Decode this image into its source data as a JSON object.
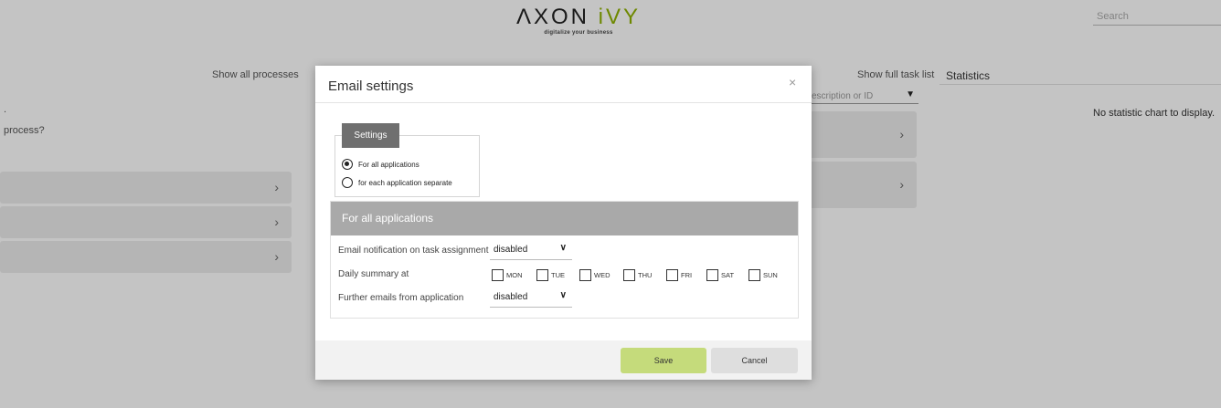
{
  "header": {
    "logo_main_prefix": "ΛXON ",
    "logo_main_accent": "iVY",
    "logo_sub": "digitalize your business",
    "search_placeholder": "Search"
  },
  "processes": {
    "show_all_label": "Show all processes",
    "dot_text": ".",
    "question_text": "process?",
    "rows": [
      "",
      "",
      ""
    ]
  },
  "tasks": {
    "show_full_label": "Show full task list",
    "filter_placeholder": "escription or ID",
    "rows": [
      "",
      ""
    ]
  },
  "statistics": {
    "title": "Statistics",
    "empty_message": "No statistic chart to display."
  },
  "icons": {
    "close": "close-icon",
    "filter": "filter-icon",
    "chevron": "chevron-right-icon",
    "dropdown": "chevron-down-icon"
  },
  "colors": {
    "brand_accent": "#8fb100",
    "save_button": "#c5db7b",
    "panel_header": "#a9a9a9",
    "settings_tab": "#6f6f6f"
  },
  "dialog": {
    "title": "Email settings",
    "close_glyph": "×",
    "settings_tab": "Settings",
    "radio_all": "For all applications",
    "radio_each": "for each application separate",
    "radio_selected": "For all applications",
    "panel_title": "For all applications",
    "task_assignment_label": "Email notification on task assignment",
    "task_assignment_value": "disabled",
    "daily_summary_label": "Daily summary at",
    "days": [
      "MON",
      "TUE",
      "WED",
      "THU",
      "FRI",
      "SAT",
      "SUN"
    ],
    "further_emails_label": "Further emails from application",
    "further_emails_value": "disabled",
    "save_label": "Save",
    "cancel_label": "Cancel"
  }
}
